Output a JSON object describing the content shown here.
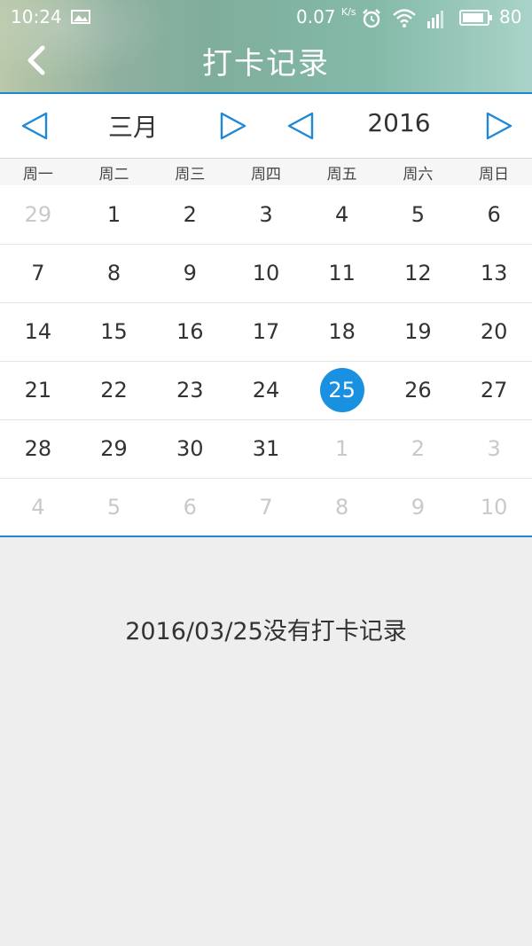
{
  "status_bar": {
    "time": "10:24",
    "net_speed": "0.07",
    "net_unit": "K/s",
    "battery": "80"
  },
  "header": {
    "title": "打卡记录"
  },
  "selector": {
    "month": "三月",
    "year": "2016"
  },
  "weekdays": [
    "周一",
    "周二",
    "周三",
    "周四",
    "周五",
    "周六",
    "周日"
  ],
  "calendar": {
    "weeks": [
      [
        {
          "d": "29",
          "m": "other"
        },
        {
          "d": "1",
          "m": "cur"
        },
        {
          "d": "2",
          "m": "cur"
        },
        {
          "d": "3",
          "m": "cur"
        },
        {
          "d": "4",
          "m": "cur"
        },
        {
          "d": "5",
          "m": "cur"
        },
        {
          "d": "6",
          "m": "cur"
        }
      ],
      [
        {
          "d": "7",
          "m": "cur"
        },
        {
          "d": "8",
          "m": "cur"
        },
        {
          "d": "9",
          "m": "cur"
        },
        {
          "d": "10",
          "m": "cur"
        },
        {
          "d": "11",
          "m": "cur"
        },
        {
          "d": "12",
          "m": "cur"
        },
        {
          "d": "13",
          "m": "cur"
        }
      ],
      [
        {
          "d": "14",
          "m": "cur"
        },
        {
          "d": "15",
          "m": "cur"
        },
        {
          "d": "16",
          "m": "cur"
        },
        {
          "d": "17",
          "m": "cur"
        },
        {
          "d": "18",
          "m": "cur"
        },
        {
          "d": "19",
          "m": "cur"
        },
        {
          "d": "20",
          "m": "cur"
        }
      ],
      [
        {
          "d": "21",
          "m": "cur"
        },
        {
          "d": "22",
          "m": "cur"
        },
        {
          "d": "23",
          "m": "cur"
        },
        {
          "d": "24",
          "m": "cur"
        },
        {
          "d": "25",
          "m": "selected"
        },
        {
          "d": "26",
          "m": "cur"
        },
        {
          "d": "27",
          "m": "cur"
        }
      ],
      [
        {
          "d": "28",
          "m": "cur"
        },
        {
          "d": "29",
          "m": "cur"
        },
        {
          "d": "30",
          "m": "cur"
        },
        {
          "d": "31",
          "m": "cur"
        },
        {
          "d": "1",
          "m": "other"
        },
        {
          "d": "2",
          "m": "other"
        },
        {
          "d": "3",
          "m": "other"
        }
      ],
      [
        {
          "d": "4",
          "m": "other"
        },
        {
          "d": "5",
          "m": "other"
        },
        {
          "d": "6",
          "m": "other"
        },
        {
          "d": "7",
          "m": "other"
        },
        {
          "d": "8",
          "m": "other"
        },
        {
          "d": "9",
          "m": "other"
        },
        {
          "d": "10",
          "m": "other"
        }
      ]
    ]
  },
  "message": "2016/03/25没有打卡记录",
  "colors": {
    "accent": "#1a90e0",
    "divider": "#1f88d6",
    "muted_day": "#c9c9c9"
  },
  "icons": {
    "back": "chevron-left-icon",
    "prev": "triangle-left-outline-icon",
    "next": "triangle-right-outline-icon"
  }
}
